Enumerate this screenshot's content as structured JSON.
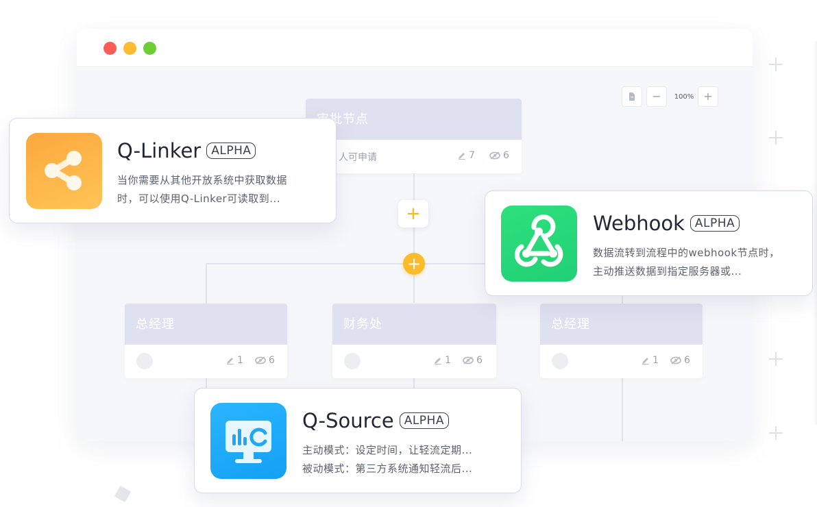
{
  "window": {
    "zoom": {
      "value": "100%",
      "minus": "−",
      "plus": "+"
    }
  },
  "flow": {
    "root": {
      "title": "审批节点",
      "subtitle": "人可申请",
      "edit_count": "7",
      "view_count": "6"
    },
    "branches": [
      {
        "title": "总经理",
        "edit_count": "1",
        "view_count": "6"
      },
      {
        "title": "财务处",
        "edit_count": "1",
        "view_count": "6"
      },
      {
        "title": "总经理",
        "edit_count": "1",
        "view_count": "6"
      }
    ],
    "add_symbol": "+"
  },
  "cards": {
    "qlinker": {
      "name": "Q-Linker",
      "badge": "ALPHA",
      "desc_line1": "当你需要从其他开放系统中获取数据",
      "desc_line2": "时，可以使用Q-Linker可读取到...",
      "icon": "share-nodes-icon",
      "color": "#fbb13c"
    },
    "webhook": {
      "name": "Webhook",
      "badge": "ALPHA",
      "desc_line1": "数据流转到流程中的webhook节点时，",
      "desc_line2": "主动推送数据到指定服务器或...",
      "icon": "webhook-icon",
      "color": "#2bdb7b"
    },
    "qsource": {
      "name": "Q-Source",
      "badge": "ALPHA",
      "desc_line1": "主动模式：设定时间，让轻流定期...",
      "desc_line2": "被动模式：第三方系统通知轻流后...",
      "icon": "monitor-chart-icon",
      "color": "#1fa6f7"
    }
  }
}
